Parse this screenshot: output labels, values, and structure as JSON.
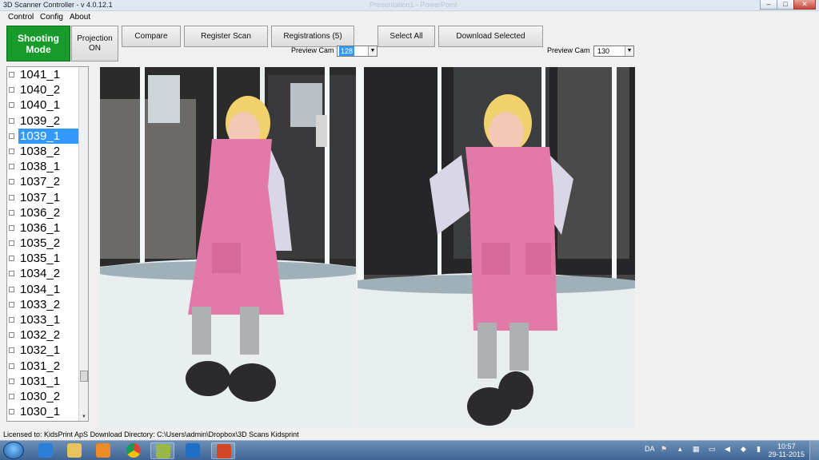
{
  "window": {
    "title": "3D Scanner Controller - v 4.0.12.1",
    "ghost_title": "Presentation1 - PowerPoint",
    "min_glyph": "–",
    "max_glyph": "□",
    "close_glyph": "✕"
  },
  "menu": {
    "items": [
      "Control",
      "Config",
      "About"
    ]
  },
  "toolbar": {
    "shooting_line1": "Shooting",
    "shooting_line2": "Mode",
    "projection_line1": "Projection",
    "projection_line2": "ON",
    "compare": "Compare",
    "register_scan": "Register Scan",
    "registrations": "Registrations  (5)",
    "select_all": "Select All",
    "download_selected": "Download Selected"
  },
  "preview_left": {
    "label": "Preview Cam",
    "value": "128"
  },
  "preview_right": {
    "label": "Preview Cam",
    "value": "130"
  },
  "scan_list": {
    "items": [
      "1041_1",
      "1040_2",
      "1040_1",
      "1039_2",
      "1039_1",
      "1038_2",
      "1038_1",
      "1037_2",
      "1037_1",
      "1036_2",
      "1036_1",
      "1035_2",
      "1035_1",
      "1034_2",
      "1034_1",
      "1033_2",
      "1033_1",
      "1032_2",
      "1032_1",
      "1031_2",
      "1031_1",
      "1030_2",
      "1030_1"
    ],
    "selected": "1039_1"
  },
  "status": {
    "text": "Licensed to: KidsPrint ApS  Download Directory:  C:\\Users\\admin\\Dropbox\\3D Scans Kidsprint"
  },
  "taskbar": {
    "language": "DA",
    "time": "10:57",
    "date": "29-11-2015",
    "icons": [
      "ie-icon",
      "explorer-icon",
      "media-player-icon",
      "chrome-icon",
      "scanner-app-icon",
      "outlook-icon",
      "powerpoint-icon"
    ]
  },
  "colors": {
    "shooting_green": "#179c2c",
    "selection_blue": "#3399ff",
    "dress_pink": "#e27aa8"
  }
}
